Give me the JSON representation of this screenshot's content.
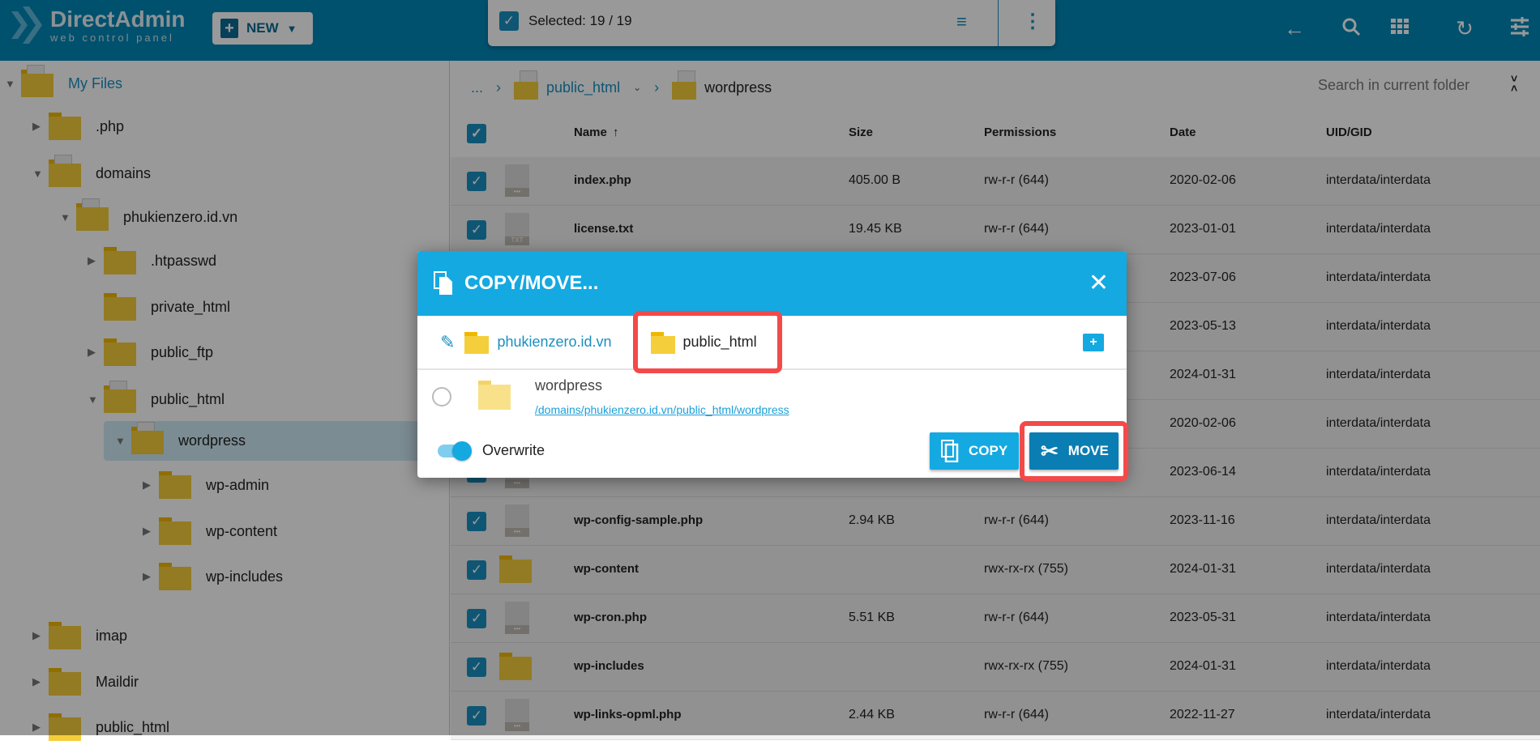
{
  "header": {
    "logo_title": "DirectAdmin",
    "logo_subtitle": "web control panel",
    "new_label": "NEW",
    "selected_text": "Selected: 19 / 19",
    "icons": [
      "back-arrow-icon",
      "search-icon",
      "grid-icon",
      "refresh-icon",
      "settings-sliders-icon"
    ]
  },
  "tree": [
    {
      "label": "My Files",
      "level": 0,
      "expanded": true,
      "type": "home"
    },
    {
      "label": ".php",
      "level": 1,
      "expanded": false,
      "type": "folder"
    },
    {
      "label": "domains",
      "level": 1,
      "expanded": true,
      "type": "open"
    },
    {
      "label": "phukienzero.id.vn",
      "level": 2,
      "expanded": true,
      "type": "open"
    },
    {
      "label": ".htpasswd",
      "level": 3,
      "expanded": false,
      "type": "folder"
    },
    {
      "label": "private_html",
      "level": 3,
      "expanded": null,
      "type": "link"
    },
    {
      "label": "public_ftp",
      "level": 3,
      "expanded": false,
      "type": "folder"
    },
    {
      "label": "public_html",
      "level": 3,
      "expanded": true,
      "type": "open"
    },
    {
      "label": "wordpress",
      "level": 4,
      "expanded": true,
      "type": "open",
      "selected": true
    },
    {
      "label": "wp-admin",
      "level": 5,
      "expanded": false,
      "type": "folder"
    },
    {
      "label": "wp-content",
      "level": 5,
      "expanded": false,
      "type": "folder"
    },
    {
      "label": "wp-includes",
      "level": 5,
      "expanded": false,
      "type": "folder"
    },
    {
      "label": "imap",
      "level": 1,
      "expanded": false,
      "type": "folder"
    },
    {
      "label": "Maildir",
      "level": 1,
      "expanded": false,
      "type": "folder"
    },
    {
      "label": "public_html",
      "level": 1,
      "expanded": false,
      "type": "folder"
    }
  ],
  "breadcrumb": {
    "ellipsis": "...",
    "parent": "public_html",
    "current": "wordpress"
  },
  "search": {
    "placeholder": "Search in current folder"
  },
  "table": {
    "columns": [
      "Name",
      "Size",
      "Permissions",
      "Date",
      "UID/GID"
    ],
    "sort": "Name ascending",
    "rows": [
      {
        "name": "index.php",
        "size": "405.00 B",
        "perm": "rw-r-r (644)",
        "date": "2020-02-06",
        "uid": "interdata/interdata",
        "type": "php"
      },
      {
        "name": "license.txt",
        "size": "19.45 KB",
        "perm": "rw-r-r (644)",
        "date": "2023-01-01",
        "uid": "interdata/interdata",
        "type": "txt"
      },
      {
        "name": "",
        "size": "",
        "perm": "",
        "date": "2023-07-06",
        "uid": "interdata/interdata",
        "type": "php"
      },
      {
        "name": "",
        "size": "",
        "perm": "",
        "date": "2023-05-13",
        "uid": "interdata/interdata",
        "type": "php"
      },
      {
        "name": "",
        "size": "",
        "perm": "",
        "date": "2024-01-31",
        "uid": "interdata/interdata",
        "type": "php"
      },
      {
        "name": "",
        "size": "",
        "perm": "",
        "date": "2020-02-06",
        "uid": "interdata/interdata",
        "type": "php"
      },
      {
        "name": "",
        "size": "",
        "perm": "",
        "date": "2023-06-14",
        "uid": "interdata/interdata",
        "type": "php"
      },
      {
        "name": "wp-config-sample.php",
        "size": "2.94 KB",
        "perm": "rw-r-r (644)",
        "date": "2023-11-16",
        "uid": "interdata/interdata",
        "type": "php"
      },
      {
        "name": "wp-content",
        "size": "",
        "perm": "rwx-rx-rx (755)",
        "date": "2024-01-31",
        "uid": "interdata/interdata",
        "type": "folder"
      },
      {
        "name": "wp-cron.php",
        "size": "5.51 KB",
        "perm": "rw-r-r (644)",
        "date": "2023-05-31",
        "uid": "interdata/interdata",
        "type": "php"
      },
      {
        "name": "wp-includes",
        "size": "",
        "perm": "rwx-rx-rx (755)",
        "date": "2024-01-31",
        "uid": "interdata/interdata",
        "type": "folder"
      },
      {
        "name": "wp-links-opml.php",
        "size": "2.44 KB",
        "perm": "rw-r-r (644)",
        "date": "2022-11-27",
        "uid": "interdata/interdata",
        "type": "php"
      }
    ]
  },
  "dialog": {
    "title": "COPY/MOVE...",
    "crumb_parent": "phukienzero.id.vn",
    "crumb_current": "public_html",
    "item_name": "wordpress",
    "item_path": "/domains/phukienzero.id.vn/public_html/wordpress",
    "overwrite_label": "Overwrite",
    "overwrite_on": true,
    "copy_label": "COPY",
    "move_label": "MOVE"
  },
  "colors": {
    "header": "#0087b8",
    "accent": "#15a9e1",
    "highlight": "#f44949",
    "move": "#0a7db3"
  }
}
